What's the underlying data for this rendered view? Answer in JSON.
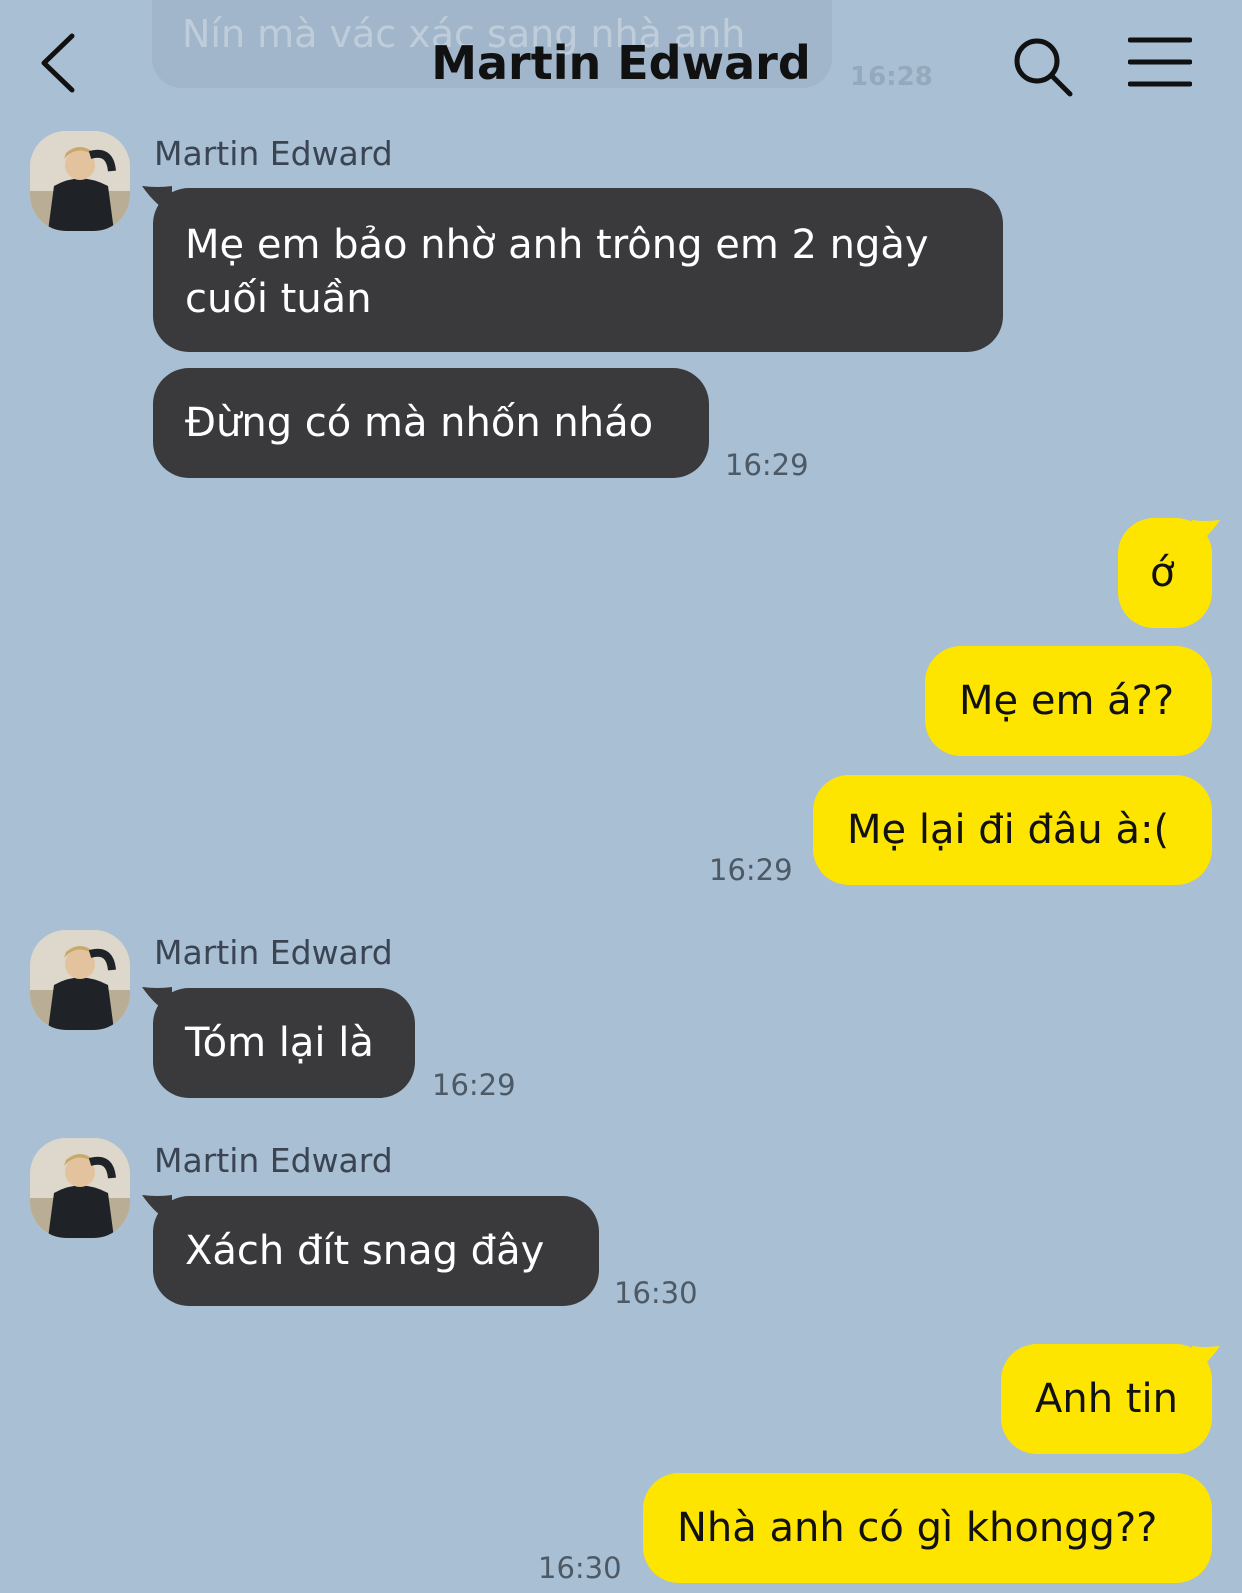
{
  "header": {
    "title": "Martin Edward",
    "faded_message": "Nín mà vác xác sang nhà anh",
    "faded_time": "16:28"
  },
  "icons": {
    "back": "chevron-left-icon",
    "search": "search-icon",
    "menu": "hamburger-menu-icon"
  },
  "colors": {
    "background": "#a9bfd3",
    "incoming_bubble": "#3a3a3c",
    "outgoing_bubble": "#fee500"
  },
  "messages": {
    "group1": {
      "sender": "Martin Edward",
      "msg1": "Mẹ em bảo nhờ anh trông em 2 ngày cuối tuần",
      "msg1_line1": "Mẹ em bảo nhờ anh trông em 2 ngày",
      "msg1_line2": "cuối tuần",
      "msg2": "Đừng có mà nhốn nháo",
      "time": "16:29"
    },
    "group2": {
      "msg1": "ớ",
      "msg2": "Mẹ em á??",
      "msg3": "Mẹ lại đi đâu à:(",
      "time": "16:29"
    },
    "group3": {
      "sender": "Martin Edward",
      "msg1": "Tóm lại là",
      "time": "16:29"
    },
    "group4": {
      "sender": "Martin Edward",
      "msg1": "Xách đít snag đây",
      "time": "16:30"
    },
    "group5": {
      "msg1": "Anh tin",
      "msg2": "Nhà anh có gì khongg??",
      "time": "16:30"
    }
  }
}
